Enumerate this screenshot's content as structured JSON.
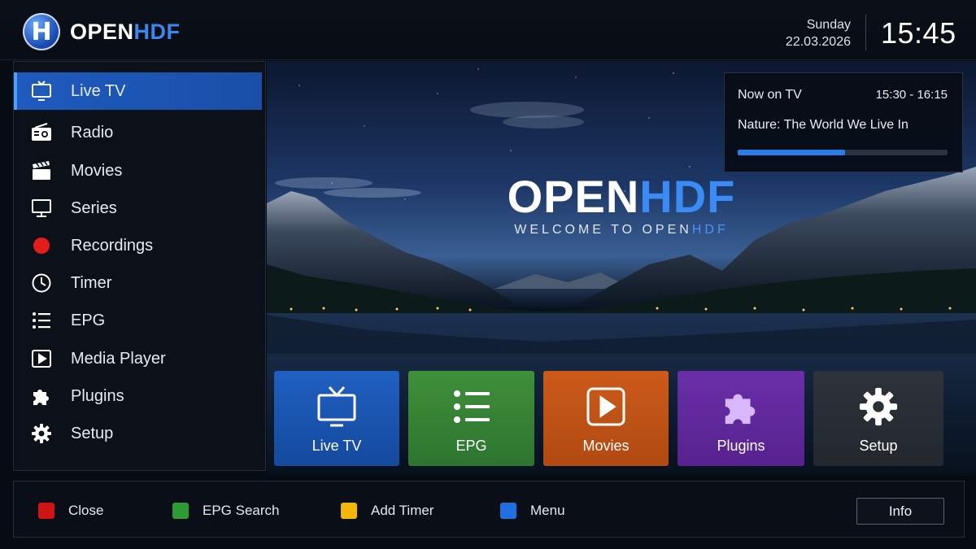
{
  "header": {
    "logo_mark": "H",
    "brand_part1": "OPEN",
    "brand_part2": "HDF",
    "day": "Sunday",
    "date": "22.03.2026",
    "time": "15:45"
  },
  "sidebar": {
    "items": [
      {
        "label": "Live TV",
        "icon": "tv-icon",
        "active": true
      },
      {
        "label": "Radio",
        "icon": "radio-icon"
      },
      {
        "label": "Movies",
        "icon": "clapperboard-icon"
      },
      {
        "label": "Series",
        "icon": "monitor-icon"
      },
      {
        "label": "Recordings",
        "icon": "record-dot-icon"
      },
      {
        "label": "Timer",
        "icon": "clock-icon"
      },
      {
        "label": "EPG",
        "icon": "list-icon"
      },
      {
        "label": "Media Player",
        "icon": "play-square-icon"
      },
      {
        "label": "Plugins",
        "icon": "puzzle-icon"
      },
      {
        "label": "Setup",
        "icon": "gear-icon"
      }
    ]
  },
  "hero": {
    "title_part1": "OPEN",
    "title_part2": "HDF",
    "subtitle_part1": "WELCOME TO OPEN",
    "subtitle_part2": "HDF"
  },
  "now_on_tv": {
    "label": "Now on TV",
    "time_range": "15:30 - 16:15",
    "program": "Nature: The World We Live In",
    "progress_fraction": 0.51
  },
  "tiles": [
    {
      "label": "Live TV",
      "icon": "tv-icon",
      "color": "#1f5fc0"
    },
    {
      "label": "EPG",
      "icon": "list-icon",
      "color": "#3f8f3a"
    },
    {
      "label": "Movies",
      "icon": "play-square-icon",
      "color": "#cc5a1a"
    },
    {
      "label": "Plugins",
      "icon": "puzzle-icon",
      "color": "#6a2fa8"
    },
    {
      "label": "Setup",
      "icon": "gear-icon",
      "color": "#2e333b"
    }
  ],
  "footer": {
    "keys": [
      {
        "label": "Close",
        "color": "#d01414"
      },
      {
        "label": "EPG Search",
        "color": "#2e9a35"
      },
      {
        "label": "Add Timer",
        "color": "#f2b705"
      },
      {
        "label": "Menu",
        "color": "#1f6fe0"
      }
    ],
    "info_label": "Info"
  },
  "colors": {
    "accent": "#3b86f0",
    "active_item": "#1e5bbd"
  }
}
